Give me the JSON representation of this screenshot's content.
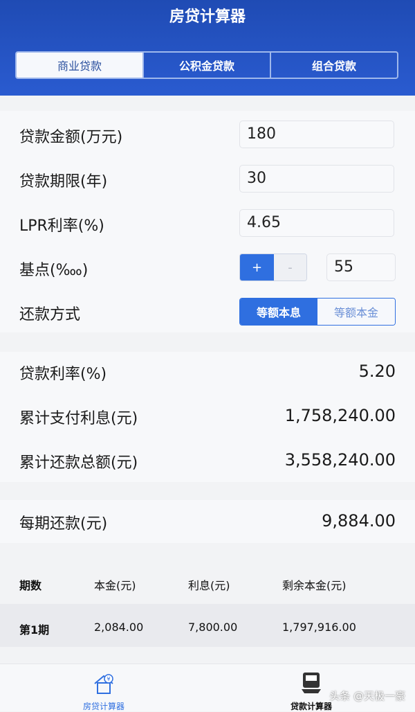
{
  "app_title": "房贷计算器",
  "tabs": [
    {
      "label": "商业贷款",
      "active": true
    },
    {
      "label": "公积金贷款",
      "active": false
    },
    {
      "label": "组合贷款",
      "active": false
    }
  ],
  "inputs": {
    "amount": {
      "label": "贷款金额(万元)",
      "value": "180"
    },
    "term": {
      "label": "贷款期限(年)",
      "value": "30"
    },
    "lpr": {
      "label": "LPR利率(%)",
      "value": "4.65"
    },
    "basis": {
      "label": "基点(‱)",
      "plus": "+",
      "minus": "-",
      "value": "55"
    },
    "method": {
      "label": "还款方式",
      "options": [
        "等额本息",
        "等额本金"
      ],
      "selected": "等额本息"
    }
  },
  "results": {
    "rate": {
      "label": "贷款利率(%)",
      "value": "5.20"
    },
    "interest": {
      "label": "累计支付利息(元)",
      "value": "1,758,240.00"
    },
    "total": {
      "label": "累计还款总额(元)",
      "value": "3,558,240.00"
    },
    "monthly": {
      "label": "每期还款(元)",
      "value": "9,884.00"
    }
  },
  "table": {
    "headers": [
      "期数",
      "本金(元)",
      "利息(元)",
      "剩余本金(元)"
    ],
    "rows": [
      [
        "第1期",
        "2,084.00",
        "7,800.00",
        "1,797,916.00"
      ]
    ]
  },
  "bottom_nav": [
    {
      "label": "房贷计算器",
      "icon": "house-yen-icon"
    },
    {
      "label": "贷款计算器",
      "icon": "calculator-icon"
    }
  ],
  "watermark": "头条 @天极一豪",
  "colors": {
    "header_blue": "#2a5bd0",
    "accent_blue": "#2f6fe0",
    "page_bg": "#f2f3f5"
  }
}
